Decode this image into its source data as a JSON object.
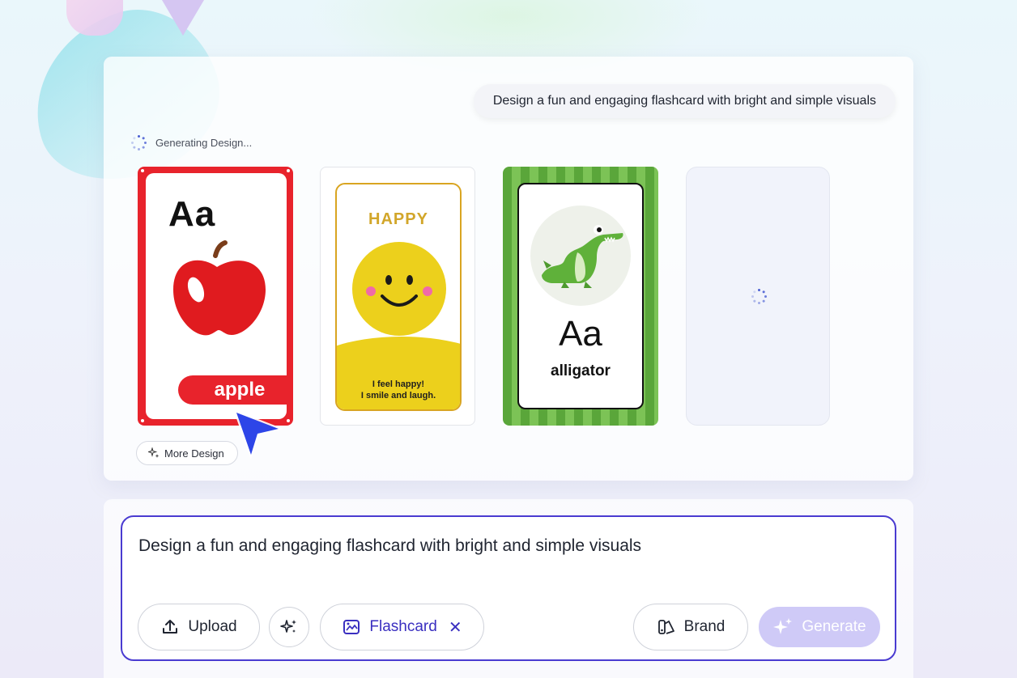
{
  "prompt_bubble": "Design a fun and engaging flashcard with bright and simple visuals",
  "status": {
    "generating_label": "Generating Design..."
  },
  "cards": {
    "apple": {
      "letters": "Aa",
      "word": "apple"
    },
    "happy": {
      "title": "HAPPY",
      "caption_line1": "I feel happy!",
      "caption_line2": "I smile and laugh."
    },
    "alligator": {
      "letters": "Aa",
      "word": "alligator"
    }
  },
  "more_design_label": "More Design",
  "composer": {
    "text": "Design a fun and engaging flashcard with bright and simple visuals",
    "upload_label": "Upload",
    "flashcard_label": "Flashcard",
    "brand_label": "Brand",
    "generate_label": "Generate"
  },
  "colors": {
    "accent": "#4a3bd1",
    "apple_red": "#e8232c",
    "happy_yellow": "#ecd01c",
    "gator_green": "#5aa63a",
    "generate_disabled": "#cfcaf7"
  },
  "icons": [
    "spinner-icon",
    "apple-icon",
    "smiley-icon",
    "alligator-icon",
    "sparkle-icon",
    "upload-icon",
    "magic-icon",
    "flashcard-icon",
    "close-icon",
    "brand-icon",
    "cursor-icon"
  ]
}
